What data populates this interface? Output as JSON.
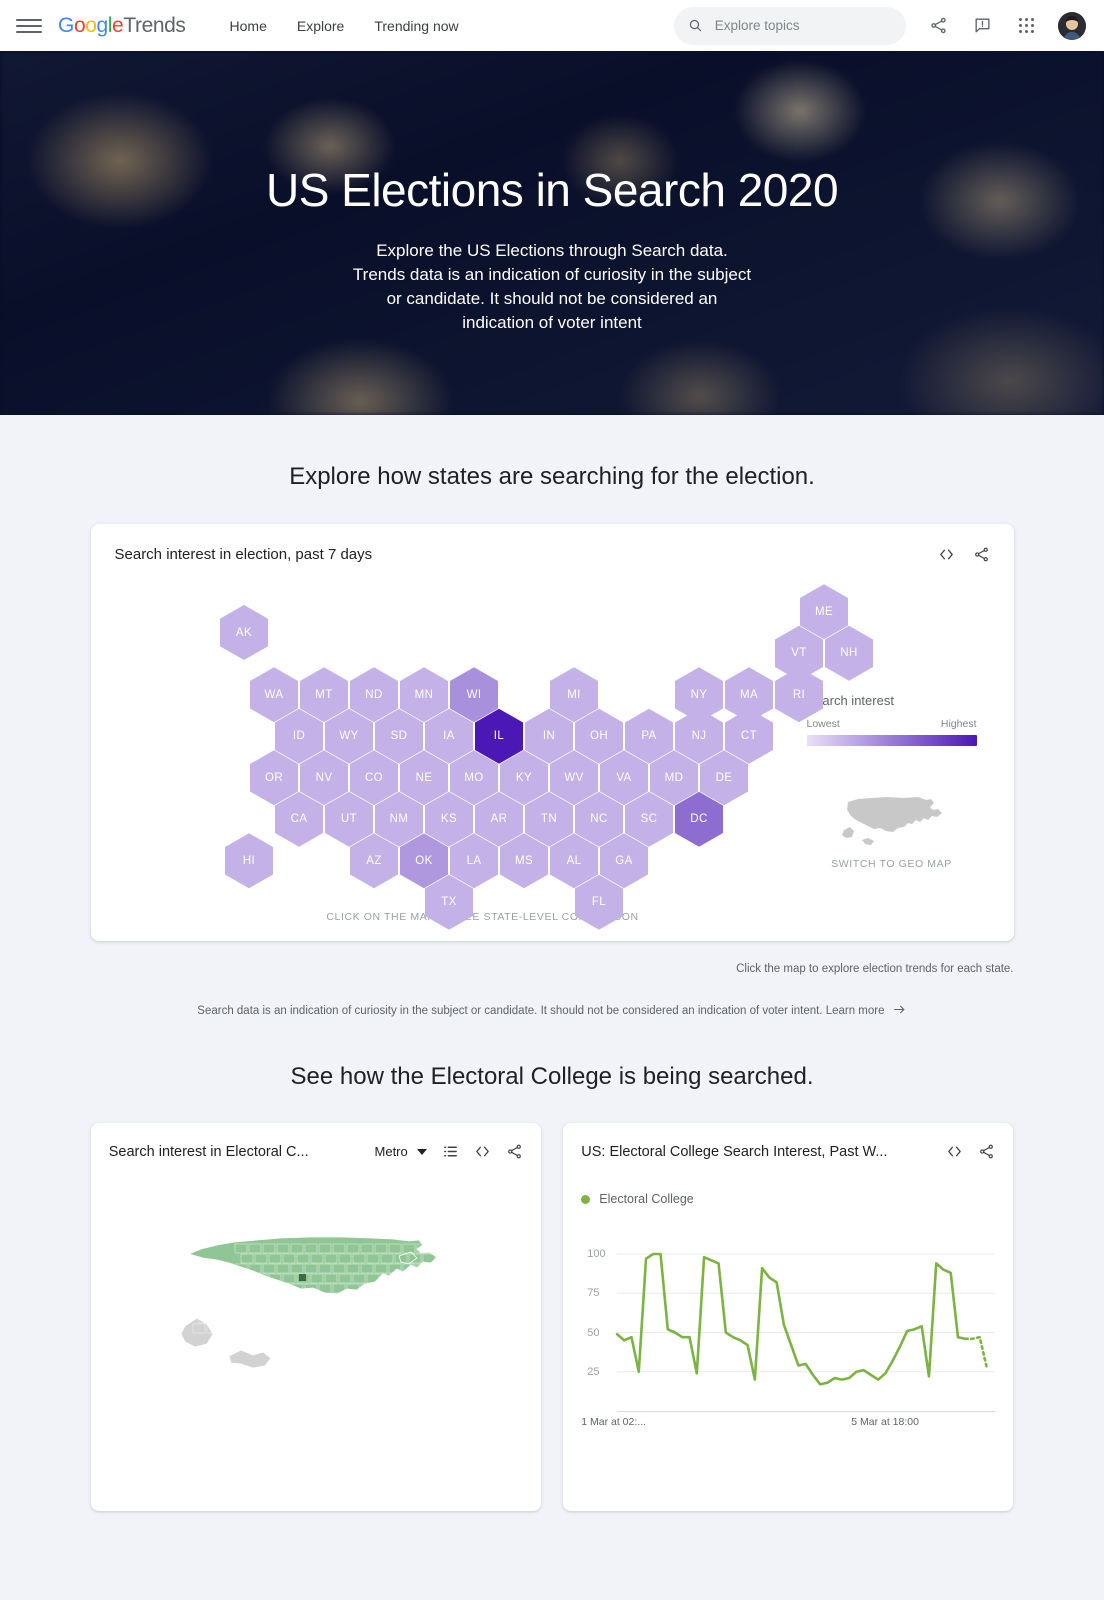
{
  "topbar": {
    "menu_icon": "hamburger-menu-icon",
    "brand": {
      "g1": "G",
      "g2": "o",
      "g3": "o",
      "g4": "g",
      "g5": "l",
      "g6": "e",
      "suffix": "Trends"
    },
    "nav": [
      {
        "label": "Home"
      },
      {
        "label": "Explore"
      },
      {
        "label": "Trending now"
      }
    ],
    "search": {
      "placeholder": "Explore topics",
      "value": "",
      "icon": "search-icon"
    },
    "icons": [
      "share-icon",
      "feedback-icon",
      "apps-grid-icon",
      "account-avatar"
    ]
  },
  "hero": {
    "title": "US Elections in Search 2020",
    "subtitle": "Explore the US Elections through Search data. Trends data is an indication of curiosity in the subject or candidate. It should not be considered an indication of voter intent"
  },
  "section1": {
    "heading": "Explore how states are searching for the election.",
    "card_title": "Search interest in election, past 7 days",
    "embed_icon": "code-embed-icon",
    "share_icon": "share-icon",
    "map_caption": "CLICK ON THE MAP TO SEE STATE-LEVEL COMPARISON",
    "legend": {
      "title": "Search interest",
      "lowest": "Lowest",
      "highest": "Highest",
      "gradient_from": "#e8e0f7",
      "gradient_to": "#4b17b5"
    },
    "geo_map": {
      "label": "SWITCH TO GEO MAP",
      "icon": "us-map-icon",
      "color": "#c8c8c8"
    },
    "note_right": "Click the map to explore election trends for each state.",
    "note_center": "Search data is an indication of curiosity in the subject or candidate. It should not be considered an indication of voter intent.",
    "note_link": "Learn more"
  },
  "cartogram": {
    "base_color": "#c8bce8",
    "states": [
      {
        "code": "AK",
        "col": 0.35,
        "row": 0,
        "shade": 0.18
      },
      {
        "code": "ME",
        "col": 11.95,
        "row": -0.5,
        "shade": 0.18
      },
      {
        "code": "VT",
        "col": 11.45,
        "row": 0.5,
        "shade": 0.18
      },
      {
        "code": "NH",
        "col": 12.45,
        "row": 0.5,
        "shade": 0.18
      },
      {
        "code": "WA",
        "col": 0.95,
        "row": 1.5,
        "shade": 0.18
      },
      {
        "code": "MT",
        "col": 1.95,
        "row": 1.5,
        "shade": 0.18
      },
      {
        "code": "ND",
        "col": 2.95,
        "row": 1.5,
        "shade": 0.18
      },
      {
        "code": "MN",
        "col": 3.95,
        "row": 1.5,
        "shade": 0.18
      },
      {
        "code": "WI",
        "col": 4.95,
        "row": 1.5,
        "shade": 0.34
      },
      {
        "code": "MI",
        "col": 6.95,
        "row": 1.5,
        "shade": 0.18
      },
      {
        "code": "NY",
        "col": 9.45,
        "row": 1.5,
        "shade": 0.18
      },
      {
        "code": "MA",
        "col": 10.45,
        "row": 1.5,
        "shade": 0.18
      },
      {
        "code": "RI",
        "col": 11.45,
        "row": 1.5,
        "shade": 0.18
      },
      {
        "code": "ID",
        "col": 1.45,
        "row": 2.5,
        "shade": 0.18
      },
      {
        "code": "WY",
        "col": 2.45,
        "row": 2.5,
        "shade": 0.18
      },
      {
        "code": "SD",
        "col": 3.45,
        "row": 2.5,
        "shade": 0.18
      },
      {
        "code": "IA",
        "col": 4.45,
        "row": 2.5,
        "shade": 0.18
      },
      {
        "code": "IL",
        "col": 5.45,
        "row": 2.5,
        "shade": 1.0
      },
      {
        "code": "IN",
        "col": 6.45,
        "row": 2.5,
        "shade": 0.18
      },
      {
        "code": "OH",
        "col": 7.45,
        "row": 2.5,
        "shade": 0.18
      },
      {
        "code": "PA",
        "col": 8.45,
        "row": 2.5,
        "shade": 0.18
      },
      {
        "code": "NJ",
        "col": 9.45,
        "row": 2.5,
        "shade": 0.18
      },
      {
        "code": "CT",
        "col": 10.45,
        "row": 2.5,
        "shade": 0.18
      },
      {
        "code": "OR",
        "col": 0.95,
        "row": 3.5,
        "shade": 0.18
      },
      {
        "code": "NV",
        "col": 1.95,
        "row": 3.5,
        "shade": 0.18
      },
      {
        "code": "CO",
        "col": 2.95,
        "row": 3.5,
        "shade": 0.18
      },
      {
        "code": "NE",
        "col": 3.95,
        "row": 3.5,
        "shade": 0.18
      },
      {
        "code": "MO",
        "col": 4.95,
        "row": 3.5,
        "shade": 0.18
      },
      {
        "code": "KY",
        "col": 5.95,
        "row": 3.5,
        "shade": 0.18
      },
      {
        "code": "WV",
        "col": 6.95,
        "row": 3.5,
        "shade": 0.18
      },
      {
        "code": "VA",
        "col": 7.95,
        "row": 3.5,
        "shade": 0.18
      },
      {
        "code": "MD",
        "col": 8.95,
        "row": 3.5,
        "shade": 0.18
      },
      {
        "code": "DE",
        "col": 9.95,
        "row": 3.5,
        "shade": 0.18
      },
      {
        "code": "CA",
        "col": 1.45,
        "row": 4.5,
        "shade": 0.18
      },
      {
        "code": "UT",
        "col": 2.45,
        "row": 4.5,
        "shade": 0.18
      },
      {
        "code": "NM",
        "col": 3.45,
        "row": 4.5,
        "shade": 0.18
      },
      {
        "code": "KS",
        "col": 4.45,
        "row": 4.5,
        "shade": 0.18
      },
      {
        "code": "AR",
        "col": 5.45,
        "row": 4.5,
        "shade": 0.18
      },
      {
        "code": "TN",
        "col": 6.45,
        "row": 4.5,
        "shade": 0.18
      },
      {
        "code": "NC",
        "col": 7.45,
        "row": 4.5,
        "shade": 0.18
      },
      {
        "code": "SC",
        "col": 8.45,
        "row": 4.5,
        "shade": 0.18
      },
      {
        "code": "DC",
        "col": 9.45,
        "row": 4.5,
        "shade": 0.52
      },
      {
        "code": "HI",
        "col": 0.45,
        "row": 5.5,
        "shade": 0.18
      },
      {
        "code": "AZ",
        "col": 2.95,
        "row": 5.5,
        "shade": 0.18
      },
      {
        "code": "OK",
        "col": 3.95,
        "row": 5.5,
        "shade": 0.3
      },
      {
        "code": "LA",
        "col": 4.95,
        "row": 5.5,
        "shade": 0.18
      },
      {
        "code": "MS",
        "col": 5.95,
        "row": 5.5,
        "shade": 0.18
      },
      {
        "code": "AL",
        "col": 6.95,
        "row": 5.5,
        "shade": 0.18
      },
      {
        "code": "GA",
        "col": 7.95,
        "row": 5.5,
        "shade": 0.18
      },
      {
        "code": "TX",
        "col": 4.45,
        "row": 6.5,
        "shade": 0.18
      },
      {
        "code": "FL",
        "col": 7.45,
        "row": 6.5,
        "shade": 0.18
      }
    ]
  },
  "section2": {
    "heading": "See how the Electoral College is being searched."
  },
  "card_left": {
    "title": "Search interest in Electoral C...",
    "dropdown_value": "Metro",
    "list_icon": "list-view-icon",
    "embed_icon": "code-embed-icon",
    "share_icon": "share-icon",
    "map_fill": "#90c695",
    "map_name": "us-metro-choropleth-map"
  },
  "card_right": {
    "title": "US: Electoral College Search Interest, Past W...",
    "embed_icon": "code-embed-icon",
    "share_icon": "share-icon"
  },
  "chart_data": {
    "type": "line",
    "title": "US: Electoral College Search Interest, Past W...",
    "legend": [
      "Electoral College"
    ],
    "legend_position": "top-left",
    "series": [
      {
        "name": "Electoral College",
        "color": "#7cb342",
        "values": [
          49,
          45,
          47,
          25,
          97,
          100,
          100,
          52,
          50,
          47,
          47,
          24,
          98,
          96,
          94,
          50,
          47,
          45,
          42,
          20,
          91,
          85,
          82,
          55,
          42,
          29,
          30,
          23,
          17,
          18,
          21,
          20,
          21,
          25,
          26,
          23,
          20,
          24,
          32,
          41,
          51,
          52,
          54,
          22,
          94,
          90,
          88,
          47,
          46,
          46,
          47,
          27
        ]
      }
    ],
    "forecast_dotted_tail": true,
    "ylim": [
      0,
      100
    ],
    "yticks": [
      25,
      50,
      75,
      100
    ],
    "xlabel": "",
    "ylabel": "",
    "xticks": [
      "1 Mar at 02:...",
      "5 Mar at 18:00"
    ],
    "grid": true
  }
}
